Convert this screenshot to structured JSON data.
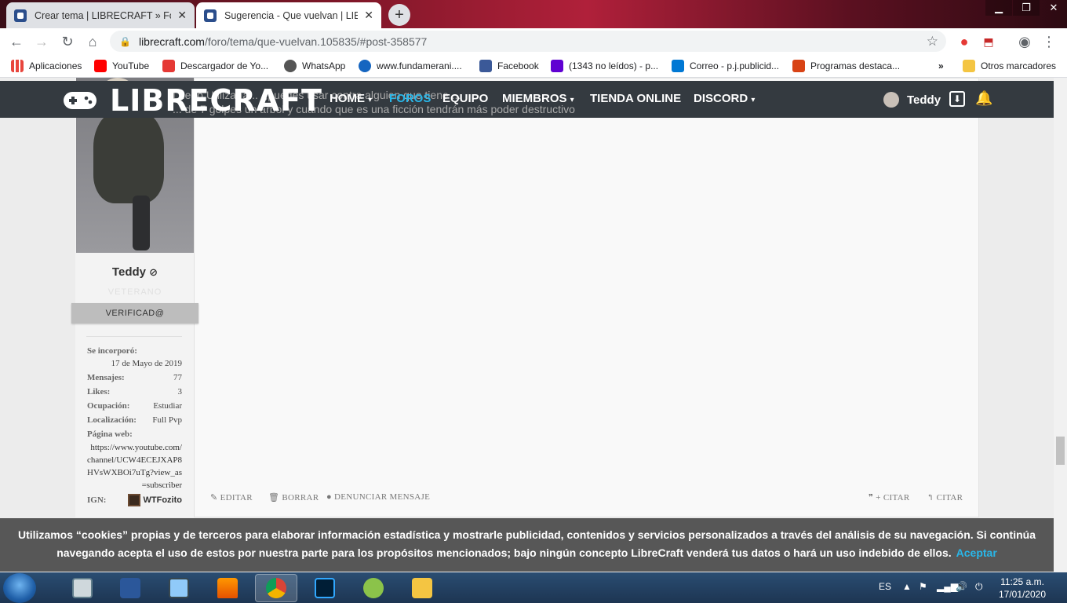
{
  "browser": {
    "tabs": [
      {
        "title": "Crear tema | LIBRECRAFT » Foro",
        "active": false
      },
      {
        "title": "Sugerencia - Que vuelvan | LIBRE",
        "active": true
      }
    ],
    "url_host": "librecraft.com",
    "url_path": "/foro/tema/que-vuelvan.105835/#post-358577",
    "bookmarks": [
      {
        "label": "Aplicaciones",
        "icon": "apps-grid-icon",
        "color": "#e8453c"
      },
      {
        "label": "YouTube",
        "icon": "youtube-icon",
        "color": "#ff0000"
      },
      {
        "label": "Descargador de Yo...",
        "icon": "download-icon",
        "color": "#e53935"
      },
      {
        "label": "WhatsApp",
        "icon": "globe-icon",
        "color": "#555555"
      },
      {
        "label": "www.fundamerani....",
        "icon": "site-icon",
        "color": "#1565c0"
      },
      {
        "label": "Facebook",
        "icon": "facebook-icon",
        "color": "#3b5998"
      },
      {
        "label": "(1343 no leídos) - p...",
        "icon": "yahoo-mail-icon",
        "color": "#6001d2"
      },
      {
        "label": "Correo - p.j.publicid...",
        "icon": "outlook-icon",
        "color": "#0078d4"
      },
      {
        "label": "Programas destaca...",
        "icon": "shield-icon",
        "color": "#d84315"
      }
    ],
    "other_bookmarks": "Otros marcadores"
  },
  "nav": {
    "logo": "LIBRECRAFT",
    "items": [
      "HOME",
      "FOROS",
      "EQUIPO",
      "MIEMBROS",
      "TIENDA ONLINE",
      "DISCORD"
    ],
    "active": "FOROS",
    "user": "Teddy",
    "ghost_line1": "Luego Utilizaría... ¿puedes usar contra alguien que tiene ...",
    "ghost_line2": "... de 7 golpes un árbol y cuando que es una ficción tendrán más poder destructivo"
  },
  "post": {
    "username": "Teddy",
    "user_title": "VETERANO",
    "badge": "VERIFICAD@",
    "stats": {
      "joined_label": "Se incorporó:",
      "joined_value": "17 de Mayo de 2019",
      "messages_label": "Mensajes:",
      "messages_value": "77",
      "likes_label": "Likes:",
      "likes_value": "3",
      "occupation_label": "Ocupación:",
      "occupation_value": "Estudiar",
      "location_label": "Localización:",
      "location_value": "Full Pvp",
      "web_label": "Página web:",
      "web_value": "https://www.youtube.com/channel/UCW4ECEJXAP8HVsWXBOi7uTg?view_as=subscriber",
      "ign_label": "IGN:",
      "ign_value": "WTFozito"
    },
    "actions": {
      "edit": "EDITAR",
      "delete": "BORRAR",
      "report": "DENUNCIAR MENSAJE",
      "multiquote": "+ CITAR",
      "quote": "CITAR"
    }
  },
  "cookie": {
    "text": "Utilizamos “cookies” propias y de terceros para elaborar información estadística y mostrarle publicidad, contenidos y servicios personalizados a través del análisis de su navegación. Si continúa navegando acepta el uso de estos por nuestra parte para los propósitos mencionados; bajo ningún concepto LibreCraft venderá tus datos o hará un uso indebido de ellos.",
    "accept": "Aceptar"
  },
  "taskbar": {
    "lang": "ES",
    "time": "11:25 a.m.",
    "date": "17/01/2020"
  }
}
